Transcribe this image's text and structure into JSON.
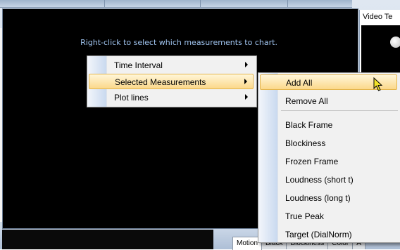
{
  "chart": {
    "hint": "Right-click to select which measurements to chart."
  },
  "right_panel": {
    "title": "Video Te"
  },
  "context_menu": {
    "items": [
      {
        "label": "Time Interval",
        "submenu": true
      },
      {
        "label": "Selected Measurements",
        "submenu": true,
        "highlighted": true
      },
      {
        "label": "Plot lines",
        "submenu": true
      }
    ]
  },
  "submenu": {
    "add_all": "Add All",
    "remove_all": "Remove All",
    "measurements": [
      "Black Frame",
      "Blockiness",
      "Frozen Frame",
      "Loudness (short t)",
      "Loudness (long t)",
      "True Peak",
      "Target (DialNorm)"
    ]
  },
  "tabs": [
    "Motion",
    "Black",
    "Blockiness",
    "Color",
    "A"
  ],
  "colors": {
    "hint_text": "#9fc3ee",
    "menu_highlight": "#fbd88a",
    "menu_highlight_border": "#e4b54d",
    "chart_background": "#000000"
  },
  "icons": [
    "submenu-arrow-icon",
    "mouse-cursor-icon"
  ]
}
